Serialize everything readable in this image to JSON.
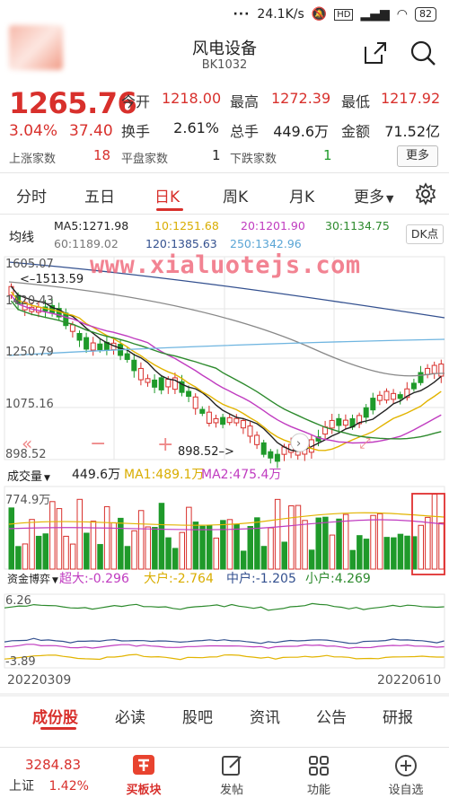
{
  "status": {
    "speed": "24.1K/s",
    "battery": "82"
  },
  "header": {
    "title": "风电设备",
    "code": "BK1032"
  },
  "quote": {
    "price": "1265.76",
    "pct": "3.04%",
    "change": "37.40",
    "open_label": "今开",
    "open": "1218.00",
    "high_label": "最高",
    "high": "1272.39",
    "low_label": "最低",
    "low": "1217.92",
    "turnover_label": "换手",
    "turnover": "2.61%",
    "volume_label": "总手",
    "volume": "449.6万",
    "amount_label": "金额",
    "amount": "71.52亿",
    "up_label": "上涨家数",
    "up": "18",
    "flat_label": "平盘家数",
    "flat": "1",
    "down_label": "下跌家数",
    "down": "1",
    "more_label": "更多"
  },
  "period_tabs": [
    "分时",
    "五日",
    "日K",
    "周K",
    "月K",
    "更多"
  ],
  "ma": {
    "title": "均线",
    "ma5": "MA5:1271.98",
    "ma10": "10:1251.68",
    "ma20": "20:1201.90",
    "ma30": "30:1134.75",
    "ma60": "60:1189.02",
    "ma120": "120:1385.63",
    "ma250": "250:1342.96",
    "dk_label": "DK点"
  },
  "colors": {
    "up": "#d8302c",
    "down": "#1f9a2a",
    "ma5": "#222222",
    "ma10": "#e2b400",
    "ma20": "#c03cc0",
    "ma30": "#2d8a2d",
    "ma60": "#888888",
    "ma120": "#33508f",
    "ma250": "#6fb5e0"
  },
  "watermark": "www.xialuotejs.com",
  "chart_axes": {
    "y_top": "1605.07",
    "y_2": "1513.59",
    "y_3": "1420.43",
    "y_4": "1250.79",
    "y_5": "1075.16",
    "y_bottom": "898.52",
    "low_mark": "898.52"
  },
  "volume": {
    "title": "成交量",
    "value": "449.6万",
    "ma1": "MA1:489.1万",
    "ma2": "MA2:475.4万",
    "axis_top": "774.9万"
  },
  "capital": {
    "title": "资金博弈",
    "big": "超大:-0.296",
    "large": "大户:-2.764",
    "mid": "中户:-1.205",
    "small": "小户:4.269",
    "y_top": "6.26",
    "y_bottom": "-3.89"
  },
  "dates": {
    "start": "20220309",
    "end": "20220610"
  },
  "bottom_tabs": [
    "成份股",
    "必读",
    "股吧",
    "资讯",
    "公告",
    "研报"
  ],
  "nav": {
    "index_name": "上证",
    "index_value": "3284.83",
    "index_pct": "1.42%",
    "buy_label": "买板块",
    "post_label": "发帖",
    "func_label": "功能",
    "settings_label": "设自选"
  }
}
